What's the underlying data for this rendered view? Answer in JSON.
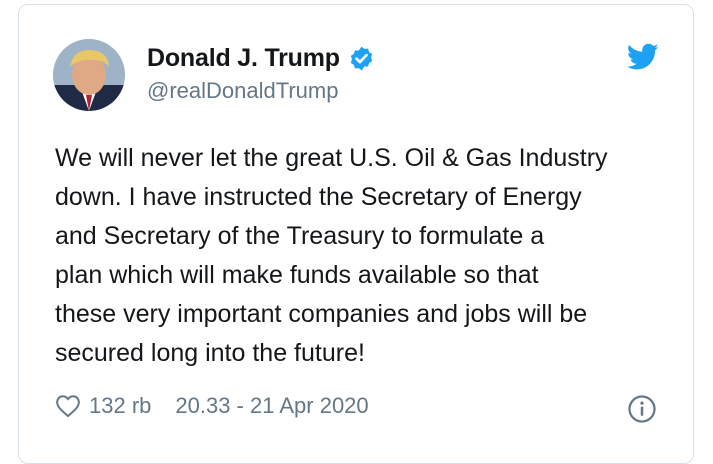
{
  "tweet": {
    "author": {
      "display_name": "Donald J. Trump",
      "handle": "@realDonaldTrump",
      "verified": true
    },
    "text_lines": [
      "We will never let the great U.S. Oil & Gas Industry",
      "down. I have instructed the Secretary of Energy",
      "and Secretary of the Treasury to formulate a",
      "plan which will make funds available so that",
      "these very important companies and jobs will be",
      "secured long into the future!"
    ],
    "likes": "132 rb",
    "timestamp": "20.33 - 21 Apr 2020"
  },
  "icons": {
    "verified": "verified-badge-icon",
    "brand": "twitter-bird-icon",
    "like": "heart-icon",
    "info": "info-icon"
  },
  "colors": {
    "twitter_blue": "#1da1f2",
    "text_primary": "#14171a",
    "text_secondary": "#657786",
    "border": "#d9e1e8"
  }
}
